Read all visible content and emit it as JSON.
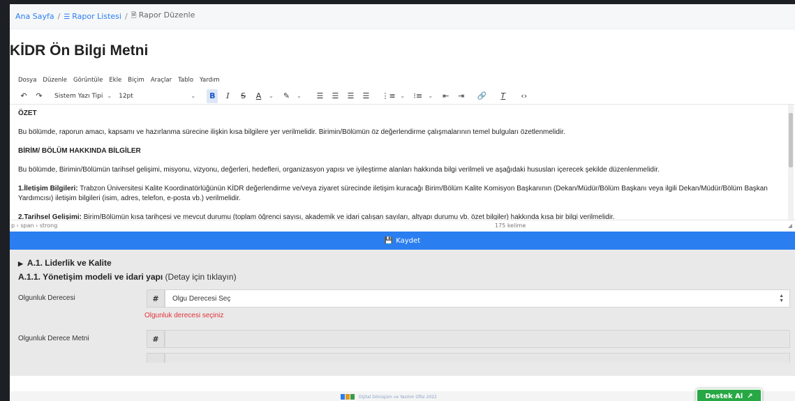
{
  "breadcrumb": {
    "home": "Ana Sayfa",
    "list": "Rapor Listesi",
    "current": "Rapor Düzenle",
    "sep": "/"
  },
  "title": "KİDR Ön Bilgi Metni",
  "menu": [
    "Dosya",
    "Düzenle",
    "Görüntüle",
    "Ekle",
    "Biçim",
    "Araçlar",
    "Tablo",
    "Yardım"
  ],
  "toolbar": {
    "font_family": "Sistem Yazı Tipi",
    "font_size": "12pt"
  },
  "editor": {
    "h1": "ÖZET",
    "p1": "Bu bölümde, raporun amacı, kapsamı ve hazırlanma sürecine ilişkin kısa bilgilere yer verilmelidir. Birimin/Bölümün öz değerlendirme çalışmalarının temel bulguları özetlenmelidir.",
    "h2": "BİRİM/ BÖLÜM HAKKINDA BİLGİLER",
    "p2": "Bu bölümde, Birimin/Bölümün tarihsel gelişimi, misyonu, vizyonu, değerleri, hedefleri, organizasyon yapısı ve iyileştirme alanları hakkında bilgi verilmeli ve aşağıdaki hususları içerecek şekilde düzenlenmelidir.",
    "p3_bold": "1.İletişim Bilgileri:",
    "p3_rest": " Trabzon Üniversitesi Kalite Koordinatörlüğünün KİDR değerlendirme ve/veya ziyaret sürecinde iletişim kuracağı Birim/Bölüm Kalite Komisyon Başkanının (Dekan/Müdür/Bölüm Başkanı veya ilgili Dekan/Müdür/Bölüm Başkan Yardımcısı) iletişim bilgileri (isim, adres, telefon, e-posta vb.) verilmelidir.",
    "p4_bold": "2.Tarihsel Gelişimi:",
    "p4_rest": " Birim/Bölümün kısa tarihçesi ve mevcut durumu (toplam öğrenci sayısı, akademik ve idari çalışan sayıları, altyapı durumu vb. özet bilgiler) hakkında kısa bir bilgi verilmelidir."
  },
  "status": {
    "path": "p › span › strong",
    "word_count": "175 kelime"
  },
  "save_label": "Kaydet",
  "section": {
    "title": "A.1. Liderlik ve Kalite",
    "subtitle": "A.1.1. Yönetişim modeli ve idari yapı",
    "detail": "(Detay için tıklayın)",
    "maturity_label": "Olgunluk Derecesi",
    "select_placeholder": "Olgu Derecesi Seç",
    "error": "Olgunluk derecesi seçiniz",
    "maturity_text_label": "Olgunluk Derece Metni",
    "hash": "#"
  },
  "footer": {
    "text": "Dijital Dönüşüm ve Yazılım Ofisi 2022"
  },
  "share_label": "Destek Al"
}
